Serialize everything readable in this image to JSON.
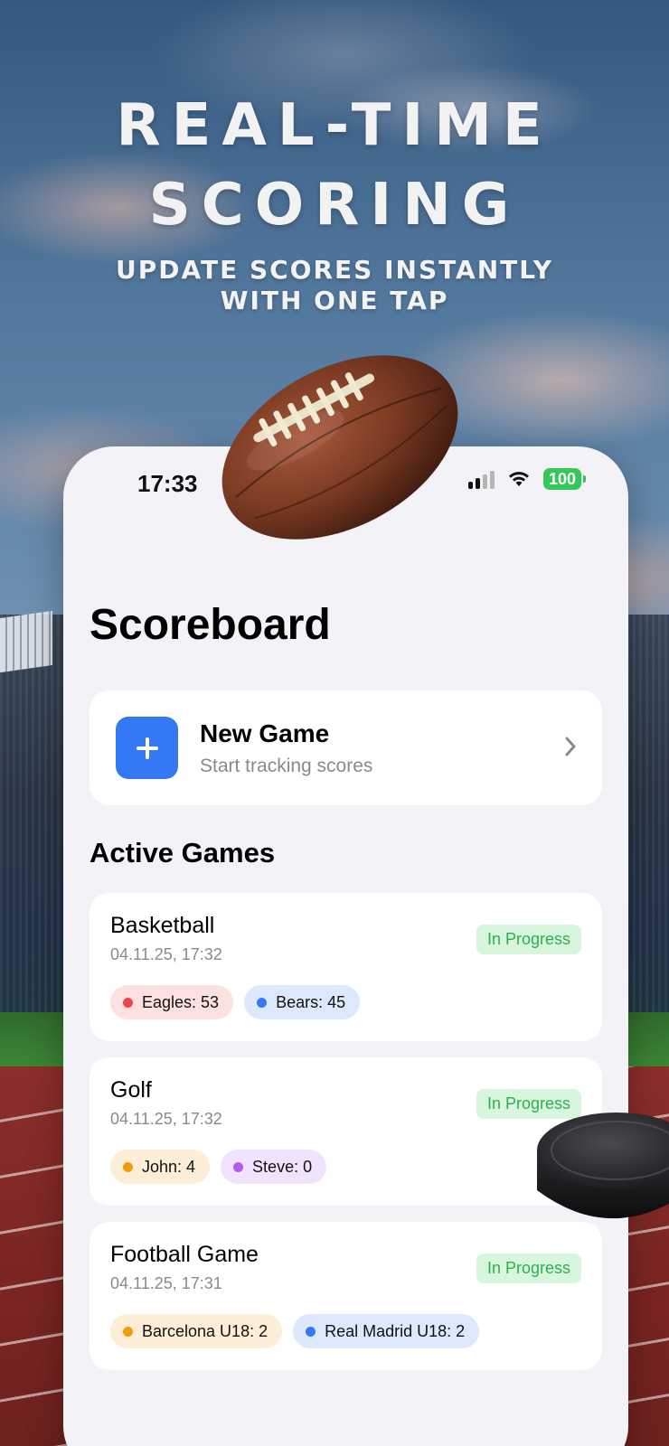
{
  "hero": {
    "title_line1": "REAL-TIME",
    "title_line2": "SCORING",
    "subtitle_line1": "UPDATE SCORES INSTANTLY",
    "subtitle_line2": "WITH ONE TAP"
  },
  "status_bar": {
    "time": "17:33",
    "battery": "100",
    "icons": [
      "signal-icon",
      "wifi-icon",
      "battery-icon"
    ]
  },
  "page": {
    "title": "Scoreboard"
  },
  "new_game": {
    "title": "New Game",
    "subtitle": "Start tracking scores",
    "icon": "plus-icon",
    "accent": "#3478f6"
  },
  "active_games": {
    "title": "Active Games",
    "games": [
      {
        "name": "Basketball",
        "date": "04.11.25, 17:32",
        "status": "In Progress",
        "scores": [
          {
            "label": "Eagles: 53",
            "dot": "#f0424a",
            "bg": "#fde0e0"
          },
          {
            "label": "Bears: 45",
            "dot": "#3478f6",
            "bg": "#dde8fc"
          }
        ]
      },
      {
        "name": "Golf",
        "date": "04.11.25, 17:32",
        "status": "In Progress",
        "scores": [
          {
            "label": "John: 4",
            "dot": "#f59a0b",
            "bg": "#fdeed7"
          },
          {
            "label": "Steve: 0",
            "dot": "#b05cf0",
            "bg": "#f1e2fd"
          }
        ]
      },
      {
        "name": "Football Game",
        "date": "04.11.25, 17:31",
        "status": "In Progress",
        "scores": [
          {
            "label": "Barcelona U18: 2",
            "dot": "#f59a0b",
            "bg": "#fdeed7"
          },
          {
            "label": "Real Madrid U18: 2",
            "dot": "#3478f6",
            "bg": "#dde8fc"
          }
        ]
      }
    ]
  },
  "colors": {
    "status_green_text": "#2fb04f",
    "status_green_bg": "#d8f5de",
    "battery_green": "#34c759"
  }
}
